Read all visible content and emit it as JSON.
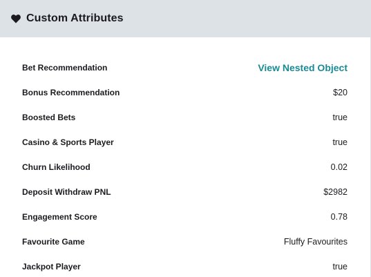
{
  "panel": {
    "title": "Custom Attributes",
    "icon": "heart-icon"
  },
  "colors": {
    "header_bg": "#dde2e6",
    "link": "#1a8a93",
    "text": "#1b1b1f"
  },
  "attributes": [
    {
      "label": "Bet Recommendation",
      "value": "View Nested Object",
      "type": "link"
    },
    {
      "label": "Bonus Recommendation",
      "value": "$20"
    },
    {
      "label": "Boosted Bets",
      "value": "true"
    },
    {
      "label": "Casino & Sports Player",
      "value": "true"
    },
    {
      "label": "Churn Likelihood",
      "value": "0.02"
    },
    {
      "label": "Deposit Withdraw PNL",
      "value": "$2982"
    },
    {
      "label": "Engagement Score",
      "value": "0.78"
    },
    {
      "label": "Favourite Game",
      "value": "Fluffy Favourites"
    },
    {
      "label": "Jackpot Player",
      "value": "true"
    }
  ]
}
